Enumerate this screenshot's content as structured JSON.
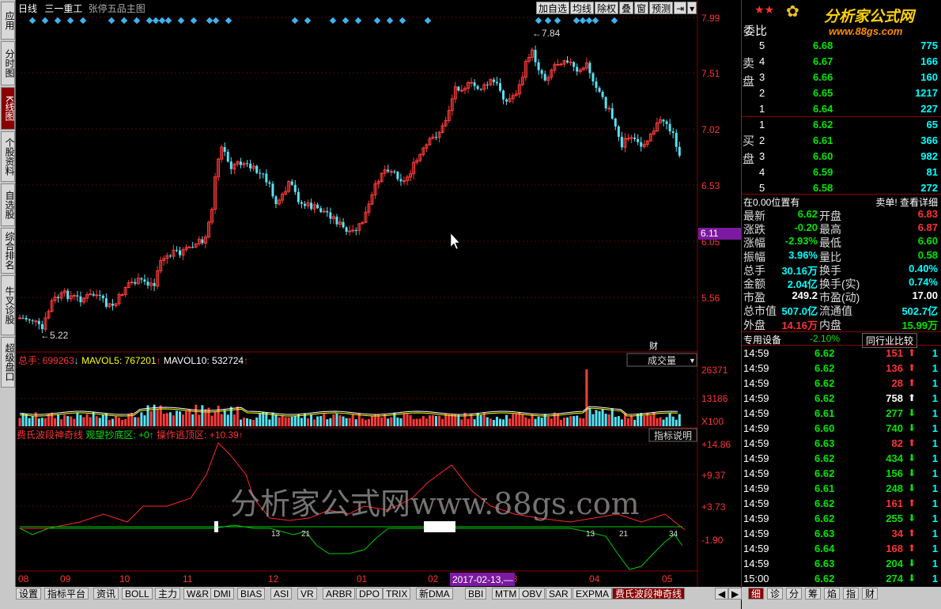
{
  "leftbar": {
    "tabs": [
      "应用",
      "分时图",
      "K线图",
      "个股资料",
      "自选股",
      "综合排名",
      "牛叉诊股",
      "超级盘口"
    ],
    "active": 2
  },
  "topbar": {
    "period": "日线",
    "stock_name": "三一重工",
    "template": "张停五品主图",
    "buttons": [
      "加自选",
      "均线",
      "除权",
      "叠",
      "窗",
      "预测"
    ]
  },
  "price_axis": [
    "7.99",
    "7.51",
    "7.02",
    "6.53",
    "6.05",
    "5.56"
  ],
  "current_price_tag": "6.11",
  "high_label": "7.84",
  "low_label": "5.22",
  "volume": {
    "label_total": "总手: 699263",
    "label_mavol5": "MAVOL5: 767201",
    "label_mavol10": "MAVOL10: 532724",
    "dropdown": "成交量",
    "axis": [
      "26371",
      "13186",
      "X100"
    ],
    "marker": "财"
  },
  "indicator": {
    "name": "费氏波段神奇线",
    "label_a": "观望抄底区: +0",
    "label_b": "操作逃顶区: +10.39",
    "button": "指标说明",
    "axis": [
      "+14.86",
      "+9.37",
      "+3.73",
      "-1.90"
    ],
    "numbers": [
      "13",
      "21",
      "13",
      "21",
      "34"
    ]
  },
  "watermark": "分析家公式网www.88gs.com",
  "xaxis": {
    "months": [
      "08",
      "09",
      "10",
      "11",
      "12",
      "01",
      "02",
      "03",
      "04",
      "05"
    ],
    "cursor_date": "2017-02-13,—"
  },
  "bottom_tabs": [
    "设置",
    "指标平台",
    "资讯",
    "BOLL",
    "主力",
    "W&R",
    "DMI",
    "BIAS",
    "ASI",
    "VR",
    "ARBR",
    "DPO",
    "TRIX",
    "新DMA",
    "BBI",
    "MTM",
    "OBV",
    "SAR",
    "EXPMA",
    "费氏波段神奇线"
  ],
  "right": {
    "logo": "分析家公式网",
    "logo_url": "www.88gs.com",
    "weibi": "委比",
    "sell_label": "卖盘",
    "buy_label": "买盘",
    "sells": [
      {
        "n": "5",
        "p": "6.68",
        "v": "775"
      },
      {
        "n": "4",
        "p": "6.67",
        "v": "166"
      },
      {
        "n": "3",
        "p": "6.66",
        "v": "160"
      },
      {
        "n": "2",
        "p": "6.65",
        "v": "1217"
      },
      {
        "n": "1",
        "p": "6.64",
        "v": "227"
      }
    ],
    "buys": [
      {
        "n": "1",
        "p": "6.62",
        "v": "65"
      },
      {
        "n": "2",
        "p": "6.61",
        "v": "366"
      },
      {
        "n": "3",
        "p": "6.60",
        "v": "982"
      },
      {
        "n": "4",
        "p": "6.59",
        "v": "81"
      },
      {
        "n": "5",
        "p": "6.58",
        "v": "272"
      }
    ],
    "pos_text": "在0.00位置有",
    "sell_detail": "卖单! 查看详细",
    "stats": [
      [
        "最新",
        "6.62",
        "开盘",
        "6.83"
      ],
      [
        "涨跌",
        "-0.20",
        "最高",
        "6.87"
      ],
      [
        "涨幅",
        "-2.93%",
        "最低",
        "6.60"
      ],
      [
        "振幅",
        "3.96%",
        "量比",
        "0.58"
      ],
      [
        "总手",
        "30.16万",
        "换手",
        "0.40%"
      ],
      [
        "金额",
        "2.04亿",
        "换手(实)",
        "0.74%"
      ],
      [
        "市盈",
        "249.2",
        "市盈(动)",
        "17.00"
      ],
      [
        "总市值",
        "507.0亿",
        "流通值",
        "502.7亿"
      ],
      [
        "外盘",
        "14.16万",
        "内盘",
        "15.99万"
      ]
    ],
    "sector": "专用设备",
    "sector_chg": "-2.10%",
    "sector_btn": "同行业比较",
    "ticks": [
      [
        "14:59",
        "6.62",
        "151",
        "up",
        "1"
      ],
      [
        "14:59",
        "6.62",
        "136",
        "up",
        "1"
      ],
      [
        "14:59",
        "6.62",
        "28",
        "up",
        "1"
      ],
      [
        "14:59",
        "6.62",
        "758",
        "upw",
        "1"
      ],
      [
        "14:59",
        "6.61",
        "277",
        "down",
        "1"
      ],
      [
        "14:59",
        "6.60",
        "740",
        "down",
        "1"
      ],
      [
        "14:59",
        "6.63",
        "82",
        "up",
        "1"
      ],
      [
        "14:59",
        "6.62",
        "434",
        "down",
        "1"
      ],
      [
        "14:59",
        "6.62",
        "156",
        "down",
        "1"
      ],
      [
        "14:59",
        "6.61",
        "248",
        "down",
        "1"
      ],
      [
        "14:59",
        "6.62",
        "161",
        "up",
        "1"
      ],
      [
        "14:59",
        "6.62",
        "255",
        "down",
        "1"
      ],
      [
        "14:59",
        "6.63",
        "34",
        "up",
        "1"
      ],
      [
        "14:59",
        "6.64",
        "168",
        "up",
        "1"
      ],
      [
        "14:59",
        "6.63",
        "204",
        "down",
        "1"
      ],
      [
        "15:00",
        "6.62",
        "274",
        "down",
        "1"
      ]
    ],
    "bottom_tabs": [
      "细",
      "诊",
      "分",
      "筹",
      "焰",
      "指",
      "财"
    ]
  }
}
